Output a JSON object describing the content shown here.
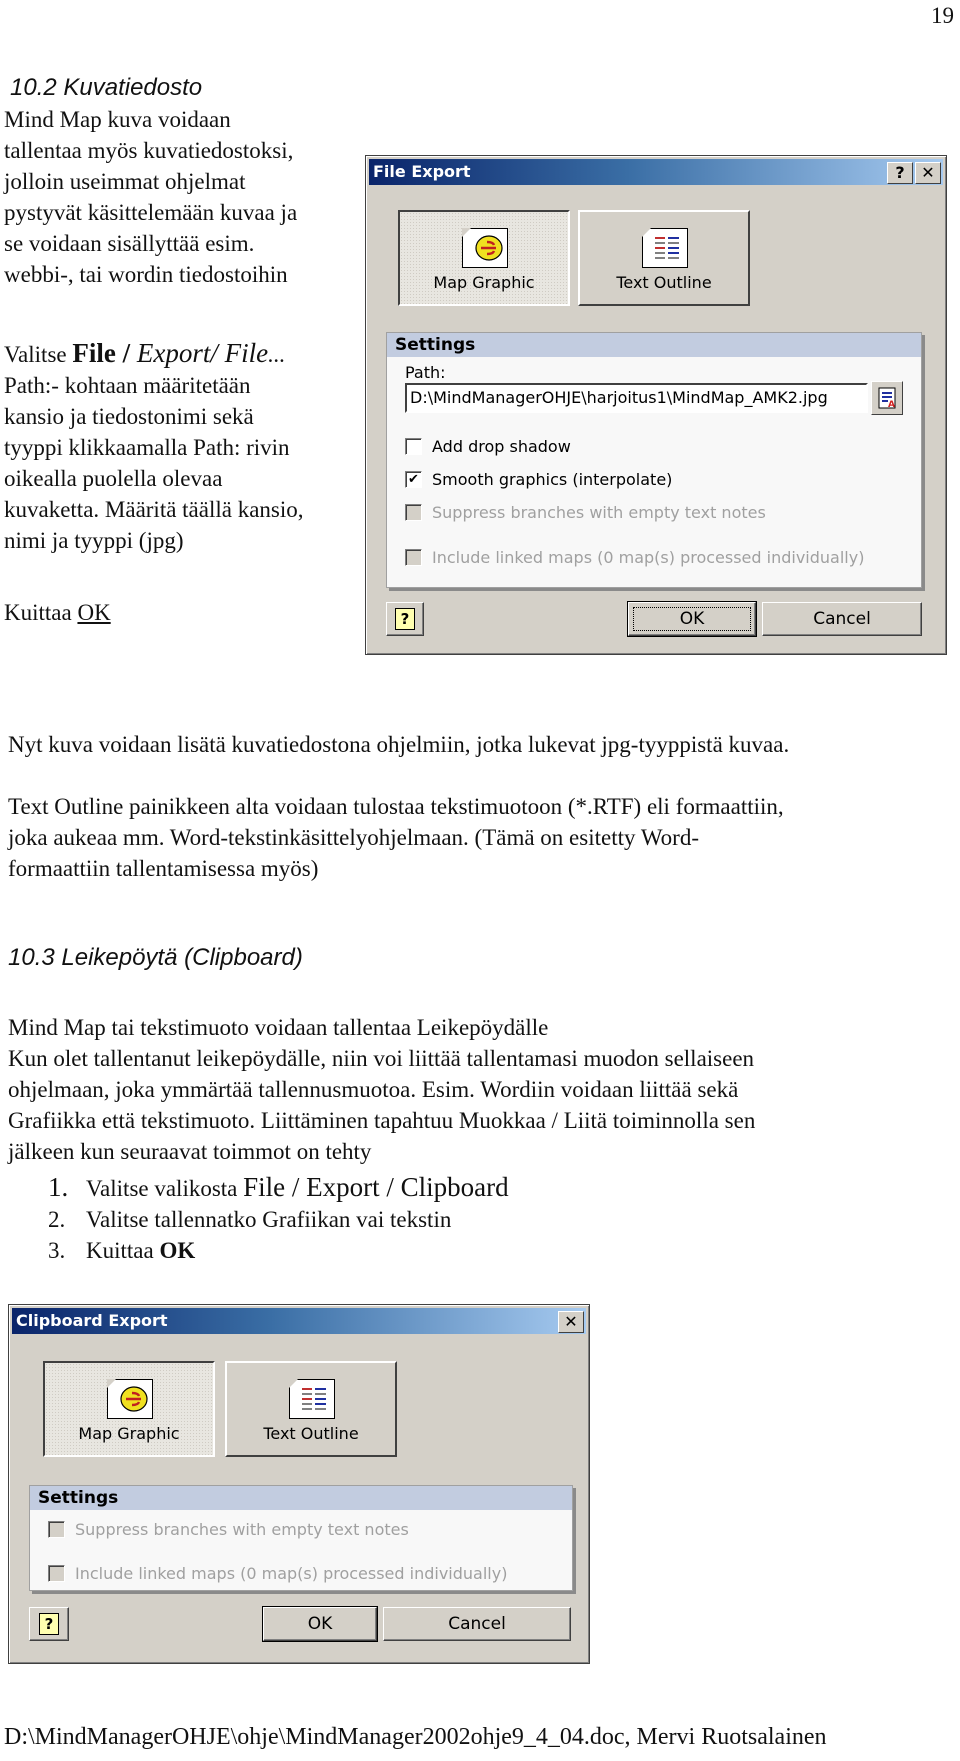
{
  "page": {
    "number": "19",
    "footer": "D:\\MindManagerOHJE\\ohje\\MindManager2002ohje9_4_04.doc, Mervi Ruotsalainen"
  },
  "section1": {
    "heading": "10.2 Kuvatiedosto",
    "intro_lines": [
      "Mind Map kuva voidaan",
      "tallentaa myös kuvatiedostoksi,",
      "jolloin useimmat ohjelmat",
      "pystyvät käsittelemään kuvaa ja",
      "se voidaan sisällyttää esim.",
      "webbi-, tai wordin tiedostoihin"
    ],
    "instruction": {
      "prefix": "Valitse ",
      "file": "File /",
      "export": " Export/ File",
      "ellipsis": "...",
      "lines": [
        "Path:- kohtaan määritetään",
        "kansio ja tiedostonimi sekä",
        "tyyppi klikkaamalla Path: rivin",
        "oikealla puolella olevaa",
        "kuvaketta. Määritä täällä kansio,",
        "nimi ja tyyppi (jpg)"
      ]
    },
    "confirm_prefix": "Kuittaa ",
    "confirm_ok": "OK",
    "para1": "Nyt kuva voidaan lisätä kuvatiedostona ohjelmiin, jotka lukevat jpg-tyyppistä kuvaa.",
    "para2_lines": [
      "Text Outline painikkeen alta voidaan tulostaa tekstimuotoon (*.RTF) eli formaattiin,",
      "joka aukeaa mm. Word-tekstinkäsittelyohjelmaan. (Tämä on esitetty Word-",
      "formaattiin tallentamisessa myös)"
    ]
  },
  "file_export_dialog": {
    "title": "File Export",
    "help_btn": "?",
    "close_btn": "✕",
    "map_graphic": "Map Graphic",
    "text_outline": "Text Outline",
    "settings_header": "Settings",
    "path_label": "Path:",
    "path_value": "D:\\MindManagerOHJE\\harjoitus1\\MindMap_AMK2.jpg",
    "options": [
      {
        "label": "Add drop shadow",
        "checked": false,
        "enabled": true
      },
      {
        "label": "Smooth graphics (interpolate)",
        "checked": true,
        "enabled": true
      },
      {
        "label": "Suppress branches with empty text notes",
        "checked": false,
        "enabled": false
      },
      {
        "label": "Include linked maps (0 map(s) processed individually)",
        "checked": false,
        "enabled": false
      }
    ],
    "help_icon": "?",
    "ok": "OK",
    "cancel": "Cancel"
  },
  "section2": {
    "heading": "10.3 Leikepöytä (Clipboard)",
    "lines": [
      "Mind Map tai tekstimuoto voidaan tallentaa Leikepöydälle",
      "Kun olet tallentanut leikepöydälle, niin voi liittää tallentamasi muodon sellaiseen",
      "ohjelmaan, joka ymmärtää tallennusmuotoa. Esim. Wordiin voidaan liittää sekä",
      "Grafiikka että tekstimuoto. Liittäminen tapahtuu Muokkaa / Liitä toiminnolla sen",
      "jälkeen kun seuraavat toimmot on tehty"
    ],
    "steps": [
      {
        "num": "1.",
        "text": "Valitse valikosta ",
        "emph": "File / Export / Clipboard"
      },
      {
        "num": "2.",
        "text": "Valitse tallennatko Grafiikan vai tekstin",
        "emph": ""
      },
      {
        "num": "3.",
        "text": "Kuittaa ",
        "emph": "OK"
      }
    ]
  },
  "clipboard_export_dialog": {
    "title": "Clipboard Export",
    "close_btn": "✕",
    "map_graphic": "Map Graphic",
    "text_outline": "Text Outline",
    "settings_header": "Settings",
    "options": [
      {
        "label": "Suppress branches with empty text notes",
        "checked": false,
        "enabled": false
      },
      {
        "label": "Include linked maps (0 map(s) processed individually)",
        "checked": false,
        "enabled": false
      }
    ],
    "help_icon": "?",
    "ok": "OK",
    "cancel": "Cancel"
  }
}
